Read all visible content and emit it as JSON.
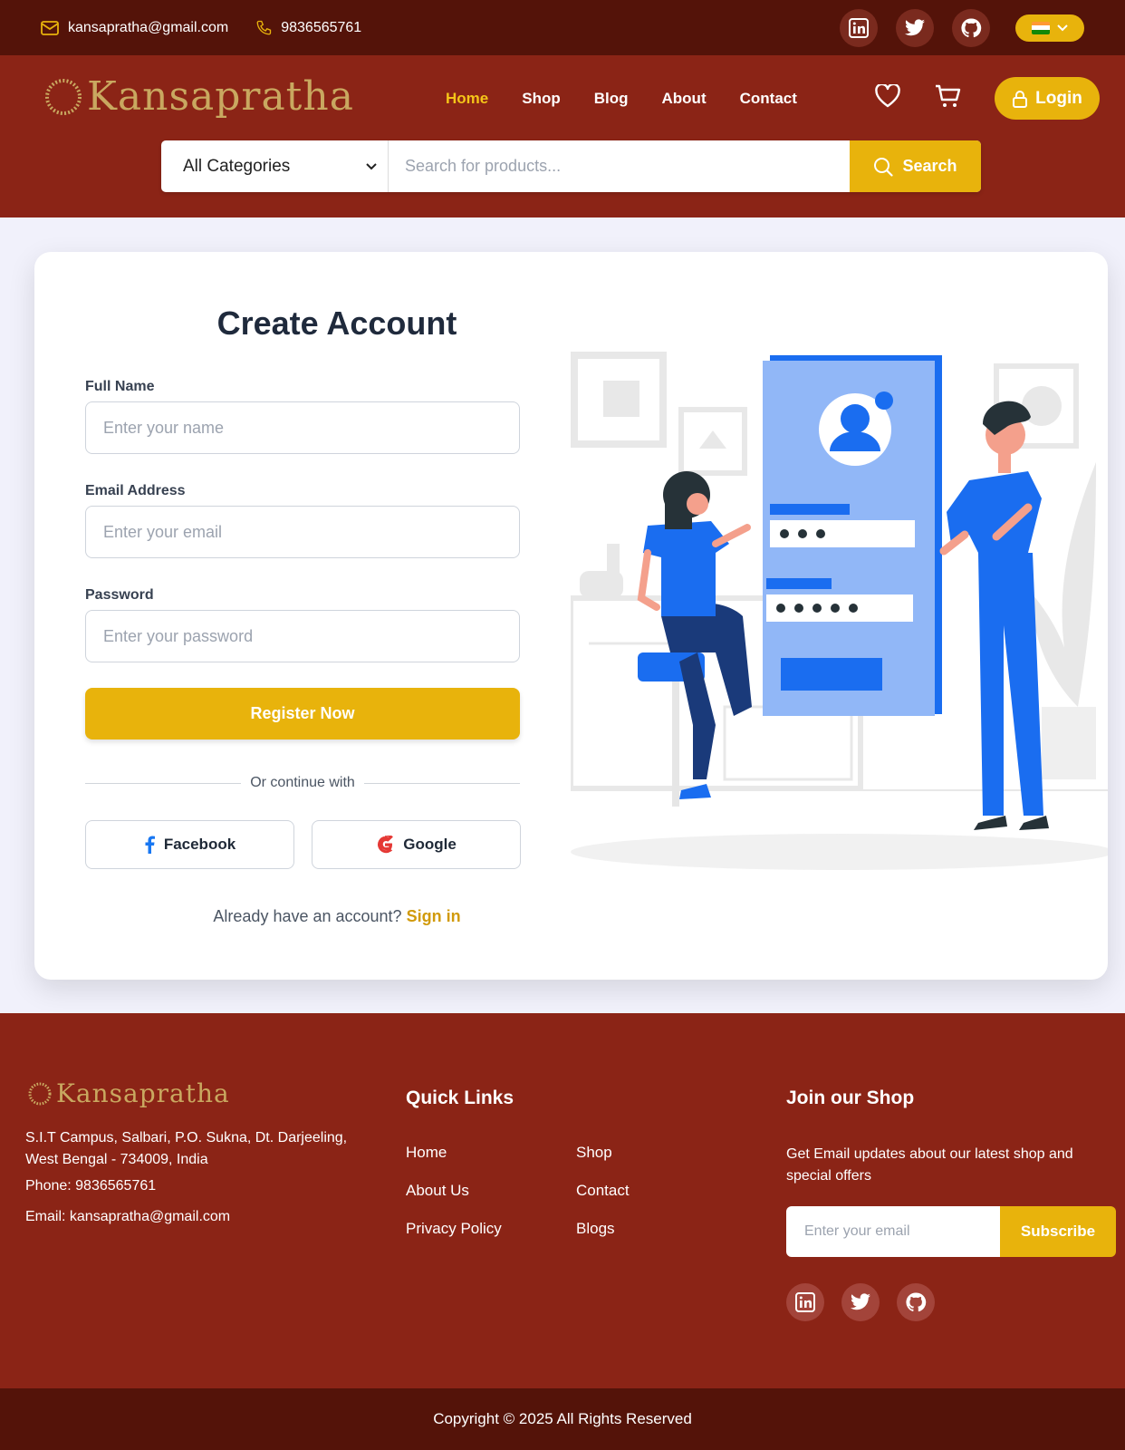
{
  "topbar": {
    "email": "kansapratha@gmail.com",
    "phone": "9836565761",
    "socials": [
      "linkedin-icon",
      "twitter-icon",
      "github-icon"
    ],
    "language_flag": "india-flag-icon"
  },
  "header": {
    "logo_text": "Kansapratha",
    "nav": [
      {
        "label": "Home",
        "active": true
      },
      {
        "label": "Shop",
        "active": false
      },
      {
        "label": "Blog",
        "active": false
      },
      {
        "label": "About",
        "active": false
      },
      {
        "label": "Contact",
        "active": false
      }
    ],
    "login_label": "Login",
    "search": {
      "category": "All Categories",
      "placeholder": "Search for products...",
      "button_label": "Search"
    }
  },
  "form": {
    "title": "Create Account",
    "full_name_label": "Full Name",
    "full_name_placeholder": "Enter your name",
    "email_label": "Email Address",
    "email_placeholder": "Enter your email",
    "password_label": "Password",
    "password_placeholder": "Enter your password",
    "register_label": "Register Now",
    "divider_text": "Or continue with",
    "facebook_label": "Facebook",
    "google_label": "Google",
    "signin_prompt": "Already have an account?",
    "signin_link": "Sign in"
  },
  "footer": {
    "logo_text": "Kansapratha",
    "address": "S.I.T Campus, Salbari, P.O. Sukna, Dt. Darjeeling, West Bengal - 734009, India",
    "phone": "Phone: 9836565761",
    "email": "Email: kansapratha@gmail.com",
    "quick_links_heading": "Quick Links",
    "quick_links": [
      "Home",
      "Shop",
      "About Us",
      "Contact",
      "Privacy Policy",
      "Blogs"
    ],
    "join_heading": "Join our Shop",
    "join_desc": "Get Email updates about our latest shop and special offers",
    "subscribe_placeholder": "Enter your email",
    "subscribe_label": "Subscribe",
    "copyright": "Copyright © 2025 All Rights Reserved"
  },
  "colors": {
    "top_bar": "#541309",
    "header": "#8b2416",
    "accent": "#e8b30c",
    "illustration_blue": "#1a6df0"
  }
}
